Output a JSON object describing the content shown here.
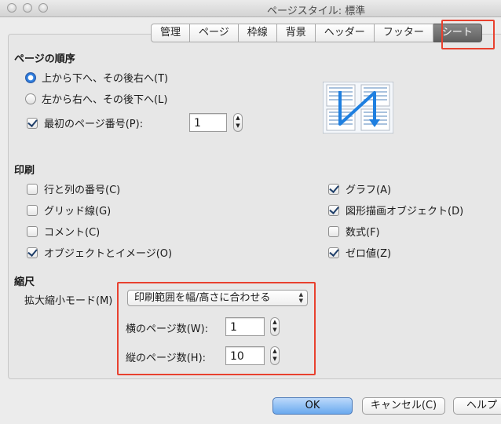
{
  "window": {
    "title": "ページスタイル: 標準"
  },
  "tabs": [
    {
      "label": "管理"
    },
    {
      "label": "ページ"
    },
    {
      "label": "枠線"
    },
    {
      "label": "背景"
    },
    {
      "label": "ヘッダー"
    },
    {
      "label": "フッター"
    },
    {
      "label": "シート",
      "active": true
    }
  ],
  "page_order": {
    "title": "ページの順序",
    "option_top_down": "上から下へ、その後右へ(T)",
    "option_left_right": "左から右へ、その後下へ(L)",
    "selected": "top_down",
    "first_page_number_label": "最初のページ番号(P):",
    "first_page_number_checked": true,
    "first_page_number_value": "1"
  },
  "print": {
    "title": "印刷",
    "items": [
      {
        "label": "行と列の番号(C)",
        "checked": false
      },
      {
        "label": "グリッド線(G)",
        "checked": false
      },
      {
        "label": "コメント(C)",
        "checked": false
      },
      {
        "label": "オブジェクトとイメージ(O)",
        "checked": true
      },
      {
        "label": "グラフ(A)",
        "checked": true
      },
      {
        "label": "図形描画オブジェクト(D)",
        "checked": true
      },
      {
        "label": "数式(F)",
        "checked": false
      },
      {
        "label": "ゼロ値(Z)",
        "checked": true
      }
    ]
  },
  "scale": {
    "title": "縮尺",
    "mode_label": "拡大縮小モード(M)",
    "mode_value": "印刷範囲を幅/高さに合わせる",
    "width_label": "横のページ数(W):",
    "width_value": "1",
    "height_label": "縦のページ数(H):",
    "height_value": "10"
  },
  "buttons": {
    "ok": "OK",
    "cancel": "キャンセル(C)",
    "help": "ヘルプ"
  },
  "colors": {
    "accent_blue": "#3d8ce6",
    "highlight_red": "#e8412f",
    "active_tab": "#6e6e6e"
  }
}
